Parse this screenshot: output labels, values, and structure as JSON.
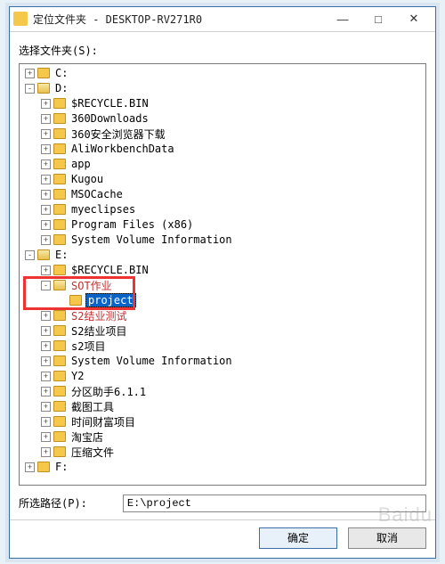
{
  "window": {
    "title": "定位文件夹 - DESKTOP-RV271R0"
  },
  "labels": {
    "choose_folder": "选择文件夹(S):",
    "selected_path": "所选路径(P):"
  },
  "tree": [
    {
      "depth": 0,
      "exp": "+",
      "label": "C:"
    },
    {
      "depth": 0,
      "exp": "-",
      "label": "D:",
      "open": true
    },
    {
      "depth": 1,
      "exp": "+",
      "label": "$RECYCLE.BIN"
    },
    {
      "depth": 1,
      "exp": "+",
      "label": "360Downloads"
    },
    {
      "depth": 1,
      "exp": "+",
      "label": "360安全浏览器下载"
    },
    {
      "depth": 1,
      "exp": "+",
      "label": "AliWorkbenchData"
    },
    {
      "depth": 1,
      "exp": "+",
      "label": "app"
    },
    {
      "depth": 1,
      "exp": "+",
      "label": "Kugou"
    },
    {
      "depth": 1,
      "exp": "+",
      "label": "MSOCache"
    },
    {
      "depth": 1,
      "exp": "+",
      "label": "myeclipses"
    },
    {
      "depth": 1,
      "exp": "+",
      "label": "Program Files (x86)"
    },
    {
      "depth": 1,
      "exp": "+",
      "label": "System Volume Information"
    },
    {
      "depth": 0,
      "exp": "-",
      "label": "E:",
      "open": true
    },
    {
      "depth": 1,
      "exp": "+",
      "label": "$RECYCLE.BIN"
    },
    {
      "depth": 1,
      "exp": "-",
      "label": "SOT作业",
      "open": true,
      "dim": true
    },
    {
      "depth": 2,
      "exp": "",
      "label": "project",
      "sel": true
    },
    {
      "depth": 1,
      "exp": "+",
      "label": "S2结业测试",
      "dim": true
    },
    {
      "depth": 1,
      "exp": "+",
      "label": "S2结业项目"
    },
    {
      "depth": 1,
      "exp": "+",
      "label": "s2项目"
    },
    {
      "depth": 1,
      "exp": "+",
      "label": "System Volume Information"
    },
    {
      "depth": 1,
      "exp": "+",
      "label": "Y2"
    },
    {
      "depth": 1,
      "exp": "+",
      "label": "分区助手6.1.1"
    },
    {
      "depth": 1,
      "exp": "+",
      "label": "截图工具"
    },
    {
      "depth": 1,
      "exp": "+",
      "label": "时间财富项目"
    },
    {
      "depth": 1,
      "exp": "+",
      "label": "淘宝店"
    },
    {
      "depth": 1,
      "exp": "+",
      "label": "压缩文件"
    },
    {
      "depth": 0,
      "exp": "+",
      "label": "F:"
    }
  ],
  "path": {
    "value": "E:\\project"
  },
  "buttons": {
    "ok": "确定",
    "cancel": "取消"
  },
  "highlight_box": {
    "top_index": 14,
    "rows": 2
  },
  "watermark": "Baidu"
}
